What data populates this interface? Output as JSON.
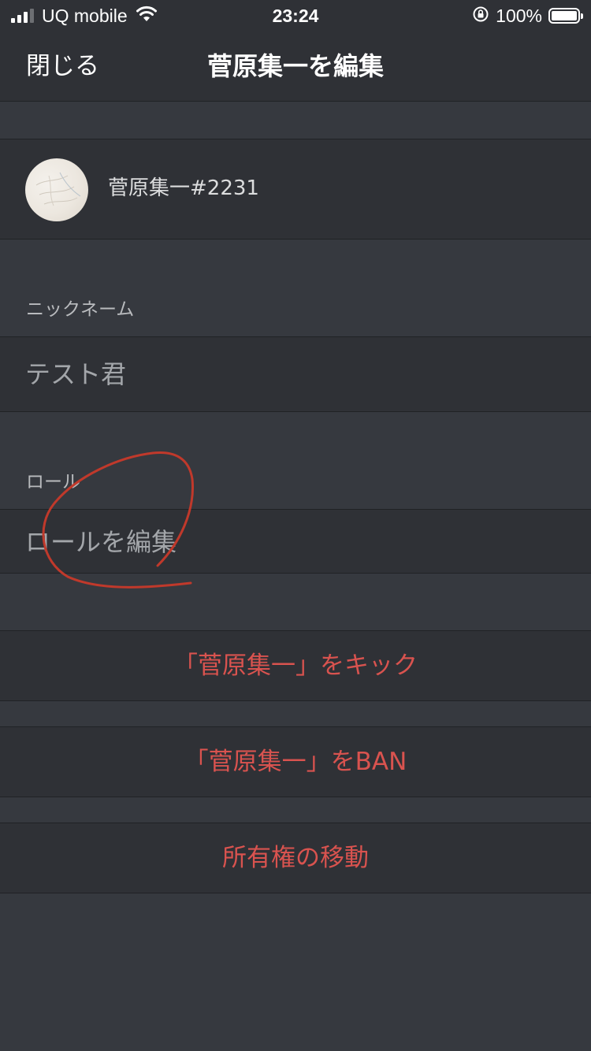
{
  "status_bar": {
    "carrier": "UQ mobile",
    "time": "23:24",
    "battery": "100%",
    "signal_bars_active": 3,
    "signal_bars_total": 4
  },
  "nav": {
    "close_label": "閉じる",
    "title": "菅原集一を編集"
  },
  "profile": {
    "username": "菅原集一#2231"
  },
  "nickname": {
    "section_label": "ニックネーム",
    "value": "テスト君"
  },
  "roles": {
    "section_label": "ロール",
    "edit_label": "ロールを編集"
  },
  "actions": {
    "kick": "「菅原集一」をキック",
    "ban": "「菅原集一」をBAN",
    "transfer": "所有権の移動"
  },
  "colors": {
    "background": "#36393f",
    "panel": "#2f3136",
    "danger": "#d9534f",
    "annotation": "#c0392b"
  },
  "icons": [
    "signal-icon",
    "wifi-icon",
    "orientation-lock-icon",
    "battery-icon"
  ]
}
